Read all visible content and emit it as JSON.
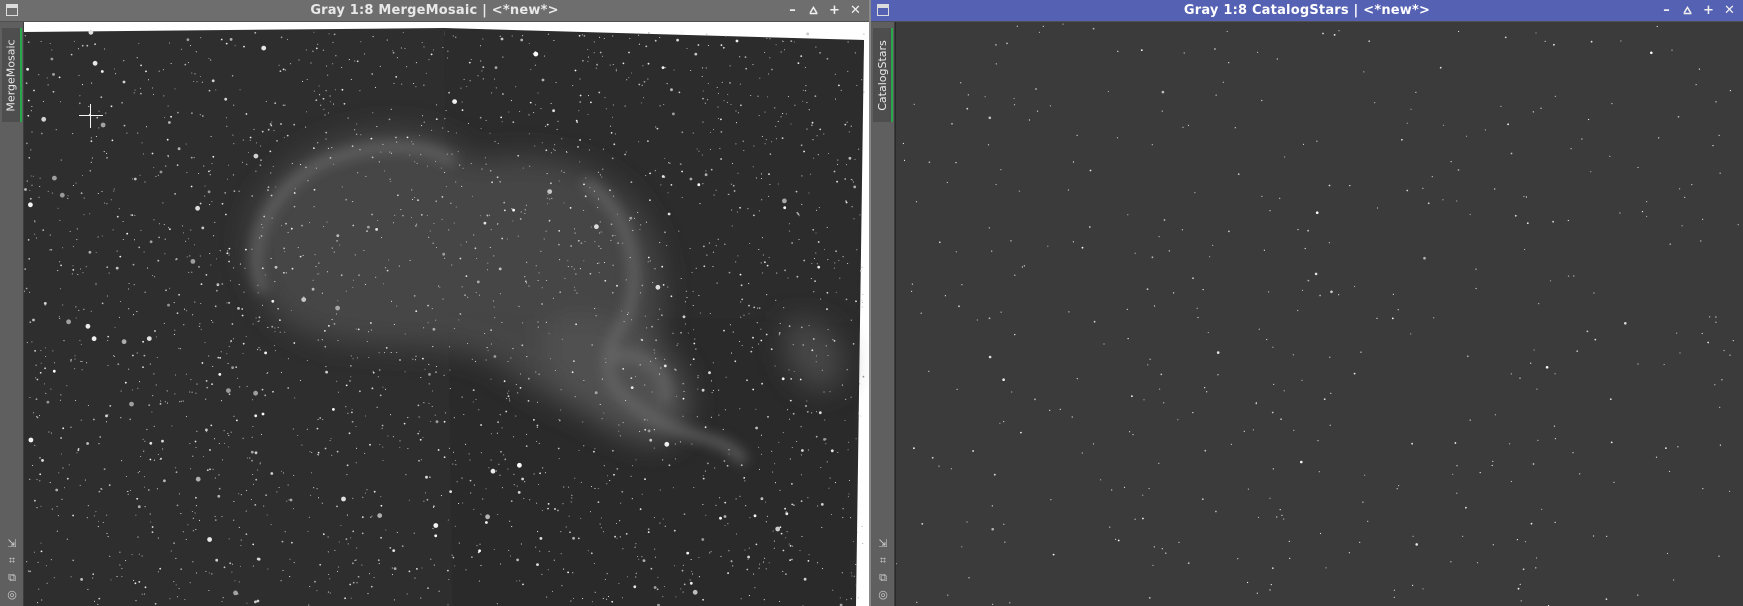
{
  "windows": [
    {
      "title": "Gray 1:8 MergeMosaic | <*new*>",
      "view_id": "MergeMosaic",
      "active": false
    },
    {
      "title": "Gray 1:8 CatalogStars | <*new*>",
      "view_id": "CatalogStars",
      "active": true
    }
  ],
  "titlebar_buttons": {
    "minimize": "–",
    "shade": "⩟",
    "maximize": "+",
    "close": "✕"
  },
  "side_tool_icons": [
    "fit-view-icon",
    "zoom-to-fit-icon",
    "clone-icon",
    "target-icon"
  ],
  "colors": {
    "active_titlebar": "#5561b3",
    "inactive_titlebar": "#6e6e6e",
    "view_tab_accent": "#27a84a",
    "workspace": "#6b6b6b"
  }
}
